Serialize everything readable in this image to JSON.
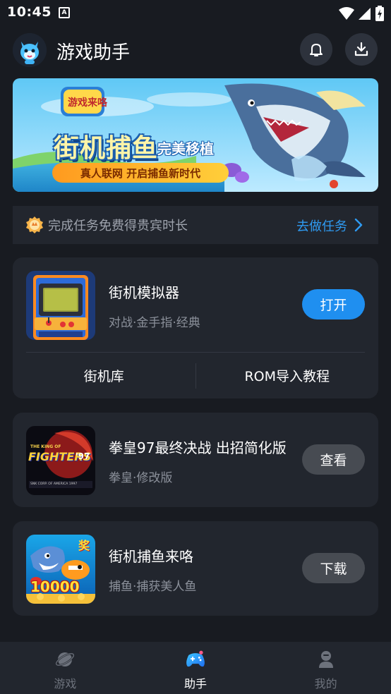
{
  "status_bar": {
    "time": "10:45",
    "notification_icon": "a-badge-icon",
    "icons": [
      "wifi-icon",
      "signal-icon",
      "battery-charging-icon"
    ]
  },
  "header": {
    "title": "游戏助手",
    "avatar_icon": "mascot-avatar-icon",
    "bell_icon": "bell-icon",
    "download_icon": "download-icon"
  },
  "banner": {
    "game_logo_text": "游戏来咯",
    "title": "街机捕鱼",
    "tag": "完美移植",
    "slogan": "真人联网 开启捕鱼新时代"
  },
  "task": {
    "icon": "medal-icon",
    "text": "完成任务免费得贵宾时长",
    "link": "去做任务",
    "link_icon": "chevron-right-icon"
  },
  "cards": [
    {
      "name": "街机模拟器",
      "desc": "对战·金手指·经典",
      "button": "打开",
      "thumb_icon": "arcade-cabinet-icon",
      "links": [
        "街机库",
        "ROM导入教程"
      ]
    },
    {
      "name": "拳皇97最终决战 出招简化版",
      "desc": "拳皇·修改版",
      "button": "查看",
      "thumb_icon": "kof97-logo-icon",
      "thumb_text_top": "THE KING OF",
      "thumb_text_main": "FIGHTERS",
      "thumb_text_num": "'97",
      "thumb_text_bottom": "SNK CORP. OF AMERICA 1997"
    },
    {
      "name": "街机捕鱼来咯",
      "desc": "捕鱼·捕获美人鱼",
      "button": "下载",
      "thumb_icon": "fishing-game-icon",
      "thumb_badge": "奖",
      "thumb_score": "10000"
    }
  ],
  "bottom_nav": {
    "items": [
      {
        "label": "游戏",
        "icon": "planet-icon",
        "active": false
      },
      {
        "label": "助手",
        "icon": "gamepad-icon",
        "active": true
      },
      {
        "label": "我的",
        "icon": "user-icon",
        "active": false
      }
    ]
  },
  "colors": {
    "background": "#181b21",
    "card": "#22262e",
    "accent": "#1f8ff0",
    "link": "#2f9bf2",
    "muted_text": "#8b909a"
  }
}
